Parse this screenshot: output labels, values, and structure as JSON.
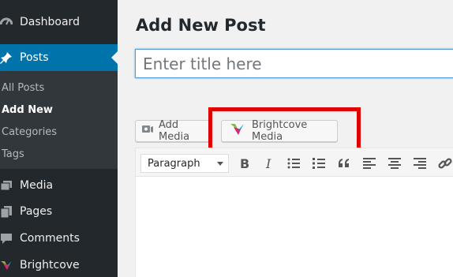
{
  "sidebar": {
    "dashboard": "Dashboard",
    "posts": "Posts",
    "posts_submenu": [
      "All Posts",
      "Add New",
      "Categories",
      "Tags"
    ],
    "media": "Media",
    "pages": "Pages",
    "comments": "Comments",
    "brightcove": "Brightcove"
  },
  "main": {
    "title": "Add New Post",
    "title_placeholder": "Enter title here",
    "add_media_label": "Add Media",
    "brightcove_media_label": "Brightcove Media",
    "format_select": "Paragraph"
  },
  "colors": {
    "sidebar_bg": "#23282d",
    "active_bg": "#0073aa",
    "highlight": "#e00000"
  }
}
